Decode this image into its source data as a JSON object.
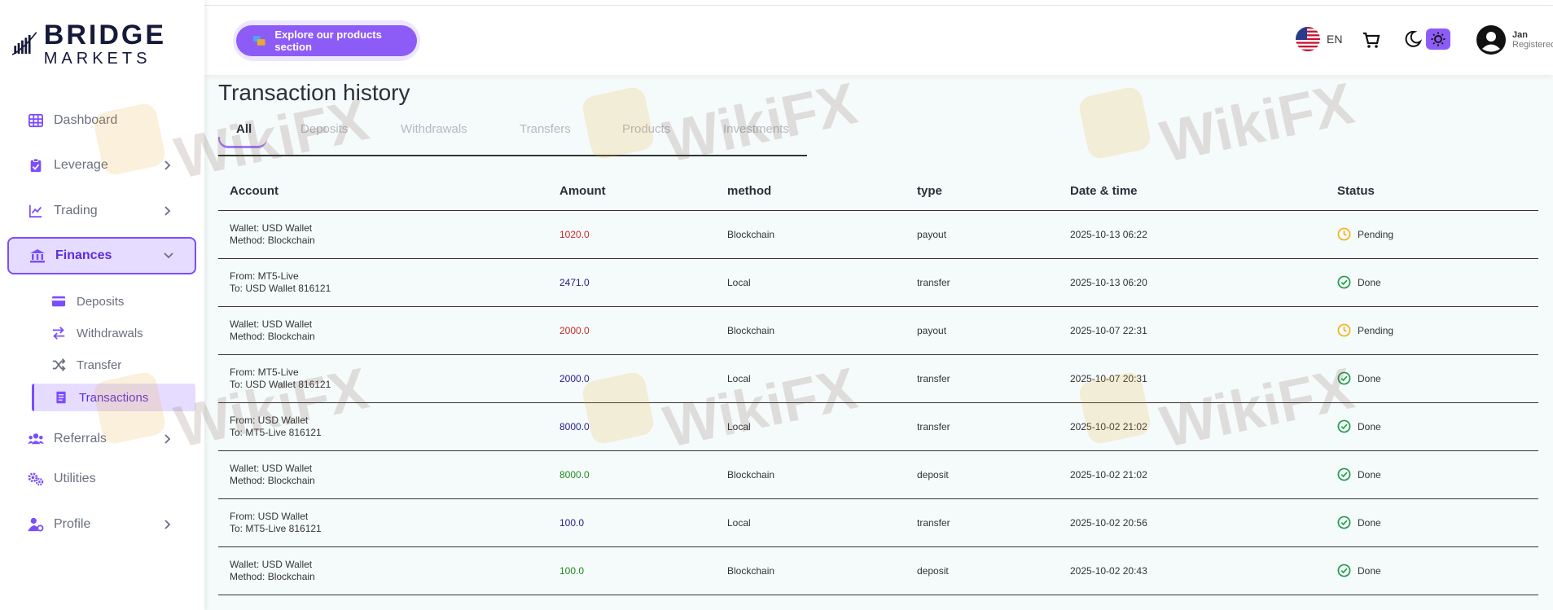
{
  "brand": {
    "line1": "BRIDGE",
    "line2": "MARKETS"
  },
  "sidebar": {
    "items": [
      {
        "label": "Dashboard",
        "icon": "dashboard-grid-icon"
      },
      {
        "label": "Leverage",
        "icon": "clipboard-icon"
      },
      {
        "label": "Trading",
        "icon": "chart-line-icon"
      },
      {
        "label": "Finances",
        "icon": "bank-icon"
      },
      {
        "label": "Referrals",
        "icon": "users-icon"
      },
      {
        "label": "Utilities",
        "icon": "gears-icon"
      },
      {
        "label": "Profile",
        "icon": "user-gear-icon"
      }
    ],
    "finances_sub": [
      {
        "label": "Deposits",
        "icon": "credit-card-icon"
      },
      {
        "label": "Withdrawals",
        "icon": "arrows-exchange-icon"
      },
      {
        "label": "Transfer",
        "icon": "shuffle-icon"
      },
      {
        "label": "Transactions",
        "icon": "receipt-icon"
      }
    ]
  },
  "topbar": {
    "explore_label": "Explore our products section",
    "language": "EN",
    "user": {
      "name": "Jan",
      "role": "Registered"
    }
  },
  "page": {
    "title": "Transaction history",
    "tabs": [
      "All",
      "Deposits",
      "Withdrawals",
      "Transfers",
      "Products",
      "Investments"
    ]
  },
  "table": {
    "headers": [
      "Account",
      "Amount",
      "method",
      "type",
      "Date & time",
      "Status"
    ],
    "rows": [
      {
        "account1": "Wallet: USD Wallet",
        "account2": "Method: Blockchain",
        "amount": "1020.0",
        "method": "Blockchain",
        "type": "payout",
        "date": "2025-10-13 06:22",
        "status": "Pending"
      },
      {
        "account1": "From: MT5-Live",
        "account2": "To: USD Wallet 816121",
        "amount": "2471.0",
        "method": "Local",
        "type": "transfer",
        "date": "2025-10-13 06:20",
        "status": "Done"
      },
      {
        "account1": "Wallet: USD Wallet",
        "account2": "Method: Blockchain",
        "amount": "2000.0",
        "method": "Blockchain",
        "type": "payout",
        "date": "2025-10-07 22:31",
        "status": "Pending"
      },
      {
        "account1": "From: MT5-Live",
        "account2": "To: USD Wallet 816121",
        "amount": "2000.0",
        "method": "Local",
        "type": "transfer",
        "date": "2025-10-07 20:31",
        "status": "Done"
      },
      {
        "account1": "From: USD Wallet",
        "account2": "To: MT5-Live 816121",
        "amount": "8000.0",
        "method": "Local",
        "type": "transfer",
        "date": "2025-10-02 21:02",
        "status": "Done"
      },
      {
        "account1": "Wallet: USD Wallet",
        "account2": "Method: Blockchain",
        "amount": "8000.0",
        "method": "Blockchain",
        "type": "deposit",
        "date": "2025-10-02 21:02",
        "status": "Done"
      },
      {
        "account1": "From: USD Wallet",
        "account2": "To: MT5-Live 816121",
        "amount": "100.0",
        "method": "Local",
        "type": "transfer",
        "date": "2025-10-02 20:56",
        "status": "Done"
      },
      {
        "account1": "Wallet: USD Wallet",
        "account2": "Method: Blockchain",
        "amount": "100.0",
        "method": "Blockchain",
        "type": "deposit",
        "date": "2025-10-02 20:43",
        "status": "Done"
      }
    ]
  },
  "watermark": "WikiFX",
  "colors": {
    "accent": "#8d5cf6",
    "active_bg": "#e6dcff",
    "payout": "#c62828",
    "transfer": "#25208a",
    "deposit": "#1f8a1f",
    "pending": "#f2b31b",
    "done": "#1f9d4a"
  }
}
